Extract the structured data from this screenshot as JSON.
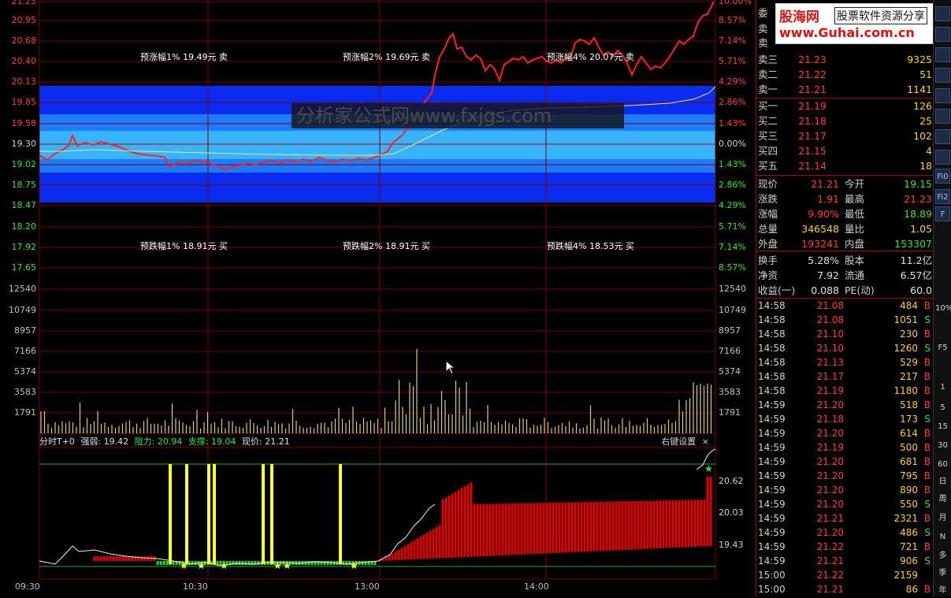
{
  "price_axis": {
    "left": [
      "21.23",
      "20.95",
      "20.68",
      "20.40",
      "20.13",
      "19.85",
      "19.58",
      "19.30",
      "19.02",
      "18.75",
      "18.47",
      "18.20",
      "17.92",
      "17.65"
    ],
    "right": [
      "10.00%",
      "8.57%",
      "7.14%",
      "5.71%",
      "4.29%",
      "2.86%",
      "1.43%",
      "0.00%",
      "1.43%",
      "2.86%",
      "4.29%",
      "5.71%",
      "7.14%",
      "8.57%"
    ]
  },
  "volume_axis": {
    "left": [
      "12540",
      "10749",
      "8957",
      "7166",
      "5374",
      "3583",
      "1791"
    ],
    "right": [
      "12540",
      "10749",
      "8957",
      "7166",
      "5374",
      "3583",
      "1791"
    ]
  },
  "indicator_axis": [
    "20.62",
    "20.03",
    "19.43"
  ],
  "time_axis": [
    "09:30",
    "10:30",
    "13:00",
    "14:00"
  ],
  "zone_labels": {
    "rise": [
      "预涨幅1% 19.49元 卖",
      "预涨幅2% 19.69元 卖",
      "预涨幅4% 20.07元 卖"
    ],
    "fall": [
      "预跌幅1% 18.91元 买",
      "预跌幅2% 18.91元 买",
      "预跌幅4% 18.53元 买"
    ]
  },
  "watermark": "分析家公式网www.fxjgs.com",
  "indicator": {
    "name": "分时T+0",
    "strength_label": "强弱: 19.42",
    "resistance_label": "阻力: 20.94",
    "support_label": "支撑: 19.04",
    "price_label": "现价: 21.21",
    "settings": "右键设置",
    "close_glyph": "×",
    "sell_mark": "卖",
    "buy_mark": "买"
  },
  "colors": {
    "up": "#ff3b3b",
    "down": "#2ee62e",
    "zone_dark": "#0a2cf0",
    "zone_mid": "#1e7bff",
    "zone_light": "#38b4ff"
  },
  "logo": {
    "name": "股海网",
    "tagline": "股票软件资源分享",
    "url": "www.Guhai.com.cn"
  },
  "panel": {
    "header_label": "委",
    "sell": [
      {
        "label": "卖三",
        "price": "21.23",
        "vol": "9325"
      },
      {
        "label": "卖二",
        "price": "21.22",
        "vol": "51"
      },
      {
        "label": "卖一",
        "price": "21.21",
        "vol": "1141"
      }
    ],
    "hidden_sell": [
      "卖",
      "卖"
    ],
    "buy": [
      {
        "label": "买一",
        "price": "21.19",
        "vol": "126"
      },
      {
        "label": "买二",
        "price": "21.18",
        "vol": "25"
      },
      {
        "label": "买三",
        "price": "21.17",
        "vol": "102"
      },
      {
        "label": "买四",
        "price": "21.15",
        "vol": "4"
      },
      {
        "label": "买五",
        "price": "21.14",
        "vol": "18"
      }
    ],
    "quote": [
      {
        "k1": "现价",
        "v1": "21.21",
        "k2": "今开",
        "v2": "19.15"
      },
      {
        "k1": "涨跌",
        "v1": "1.91",
        "k2": "最高",
        "v2": "21.23"
      },
      {
        "k1": "涨幅",
        "v1": "9.90%",
        "k2": "最低",
        "v2": "18.89"
      },
      {
        "k1": "总量",
        "v1": "346548",
        "k2": "量比",
        "v2": "1.05"
      },
      {
        "k1": "外盘",
        "v1": "193241",
        "k2": "内盘",
        "v2": "153307"
      },
      {
        "k1": "换手",
        "v1": "5.28%",
        "k2": "股本",
        "v2": "11.2亿"
      },
      {
        "k1": "净资",
        "v1": "7.92",
        "k2": "流通",
        "v2": "6.57亿"
      },
      {
        "k1": "收益(一)",
        "v1": "0.088",
        "k2": "PE(动)",
        "v2": "60.0"
      }
    ],
    "ticks": [
      {
        "t": "14:58",
        "p": "21.08",
        "v": "484",
        "bs": "B"
      },
      {
        "t": "14:58",
        "p": "21.08",
        "v": "1051",
        "bs": "S"
      },
      {
        "t": "14:58",
        "p": "21.10",
        "v": "230",
        "bs": "B"
      },
      {
        "t": "14:58",
        "p": "21.10",
        "v": "1260",
        "bs": "S"
      },
      {
        "t": "14:58",
        "p": "21.13",
        "v": "529",
        "bs": "B"
      },
      {
        "t": "14:58",
        "p": "21.17",
        "v": "217",
        "bs": "B"
      },
      {
        "t": "14:58",
        "p": "21.19",
        "v": "1180",
        "bs": "B"
      },
      {
        "t": "14:59",
        "p": "21.20",
        "v": "518",
        "bs": "B"
      },
      {
        "t": "14:59",
        "p": "21.18",
        "v": "173",
        "bs": "S"
      },
      {
        "t": "14:59",
        "p": "21.20",
        "v": "614",
        "bs": "B"
      },
      {
        "t": "14:59",
        "p": "21.19",
        "v": "500",
        "bs": "B"
      },
      {
        "t": "14:59",
        "p": "21.20",
        "v": "681",
        "bs": "B"
      },
      {
        "t": "14:59",
        "p": "21.20",
        "v": "795",
        "bs": "B"
      },
      {
        "t": "14:59",
        "p": "21.20",
        "v": "890",
        "bs": "B"
      },
      {
        "t": "14:59",
        "p": "21.20",
        "v": "550",
        "bs": "S"
      },
      {
        "t": "14:59",
        "p": "21.21",
        "v": "2321",
        "bs": "B"
      },
      {
        "t": "14:59",
        "p": "21.20",
        "v": "486",
        "bs": "S"
      },
      {
        "t": "14:59",
        "p": "21.22",
        "v": "721",
        "bs": "B"
      },
      {
        "t": "14:59",
        "p": "21.21",
        "v": "906",
        "bs": "S"
      },
      {
        "t": "15:00",
        "p": "21.22",
        "v": "2159",
        "bs": ""
      },
      {
        "t": "15:00",
        "p": "21.21",
        "v": "86",
        "bs": "B"
      }
    ]
  },
  "toolbar": [
    "10%",
    "F5",
    "1",
    "5",
    "15",
    "30",
    "60",
    "日",
    "周",
    "月",
    "N",
    "多",
    "季",
    "年"
  ],
  "toolbar_icons": [
    "Fi0",
    "Fi2",
    "F"
  ]
}
